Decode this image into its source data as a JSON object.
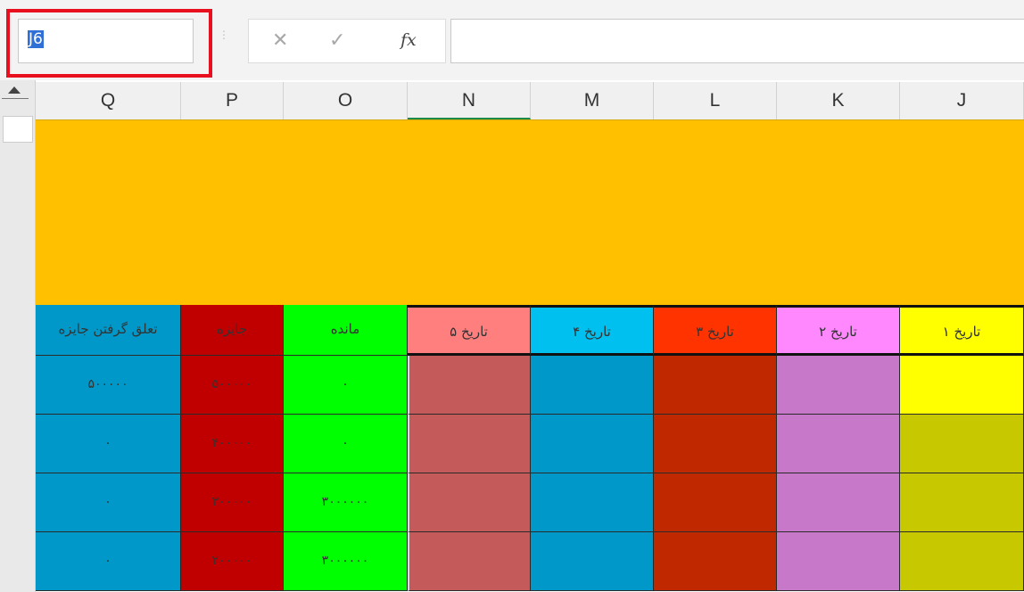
{
  "name_box": {
    "value": "J6"
  },
  "formula_bar": {
    "cancel_glyph": "✕",
    "enter_glyph": "✓",
    "fx_label": "fx",
    "formula": ""
  },
  "colors": {
    "highlight": "#e8101e",
    "banner": "#ffc000",
    "active_header_line": "#1e8a4a"
  },
  "columns": [
    {
      "letter": "Q",
      "header": "تعلق گرفتن جایزه",
      "header_color": "#0098c8",
      "values": [
        "۵۰۰۰۰۰",
        "۰",
        "۰",
        "۰"
      ],
      "cell_color": "#0098c8"
    },
    {
      "letter": "P",
      "header": "جایزه",
      "header_color": "#c00000",
      "values": [
        "۵۰۰۰۰۰",
        "۴۰۰۰۰۰",
        "۳۰۰۰۰۰",
        "۲۰۰۰۰۰"
      ],
      "cell_color": "#c00000"
    },
    {
      "letter": "O",
      "header": "مانده",
      "header_color": "#00ff00",
      "values": [
        "۰",
        "۰",
        "۳۰۰۰۰۰۰",
        "۳۰۰۰۰۰۰"
      ],
      "cell_color": "#00ff00"
    },
    {
      "letter": "N",
      "header": "تاریخ ۵",
      "header_color": "#ff7f7f",
      "values": [
        "",
        "",
        "",
        ""
      ],
      "cell_color": "#c55a5a"
    },
    {
      "letter": "M",
      "header": "تاریخ ۴",
      "header_color": "#00c0f0",
      "values": [
        "",
        "",
        "",
        ""
      ],
      "cell_color": "#0098c8"
    },
    {
      "letter": "L",
      "header": "تاریخ ۳",
      "header_color": "#ff3300",
      "values": [
        "",
        "",
        "",
        ""
      ],
      "cell_color": "#c02800"
    },
    {
      "letter": "K",
      "header": "تاریخ ۲",
      "header_color": "#ff88ff",
      "values": [
        "",
        "",
        "",
        ""
      ],
      "cell_color": "#c878c8"
    },
    {
      "letter": "J",
      "header": "تاریخ ۱",
      "header_color": "#ffff00",
      "values": [
        "",
        "",
        "",
        ""
      ],
      "cell_color": "#c8c800",
      "first_cell_color": "#ffff00"
    }
  ]
}
